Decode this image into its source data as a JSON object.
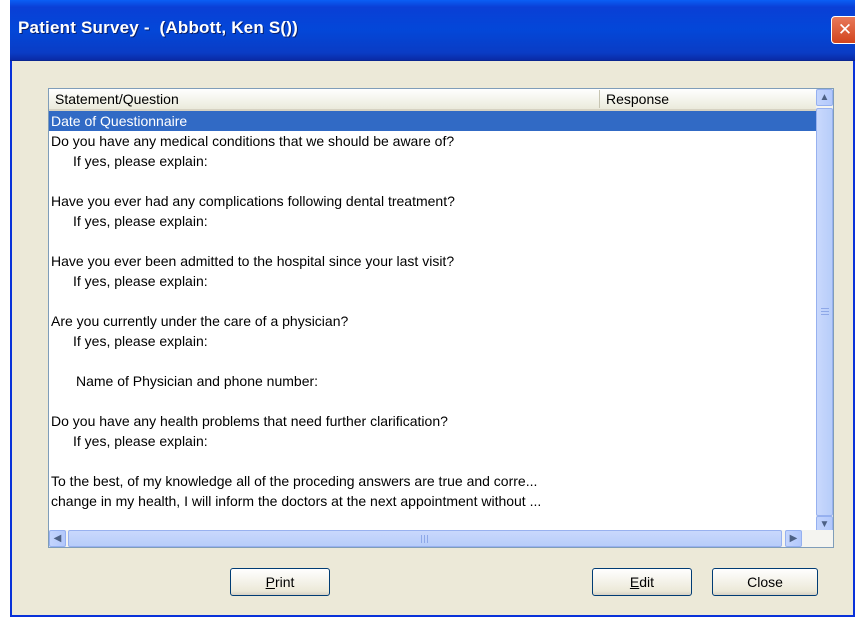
{
  "window": {
    "title": "Patient Survey -  (Abbott, Ken S())",
    "close_glyph": "✕"
  },
  "list": {
    "columns": [
      "Statement/Question",
      "Response"
    ],
    "rows": [
      {
        "text": "Date of Questionnaire",
        "indent": 0,
        "selected": true
      },
      {
        "text": "Do you have any medical conditions that we should be aware of?",
        "indent": 0
      },
      {
        "text": "If yes, please explain:",
        "indent": 1
      },
      {
        "text": "",
        "indent": 0
      },
      {
        "text": "Have you ever had any complications following dental treatment?",
        "indent": 0
      },
      {
        "text": "If yes, please explain:",
        "indent": 1
      },
      {
        "text": "",
        "indent": 0
      },
      {
        "text": "Have you ever been admitted to the hospital since your last visit?",
        "indent": 0
      },
      {
        "text": "If yes, please explain:",
        "indent": 1
      },
      {
        "text": "",
        "indent": 0
      },
      {
        "text": "Are you currently under the care of a physician?",
        "indent": 0
      },
      {
        "text": "If yes, please explain:",
        "indent": 1
      },
      {
        "text": "",
        "indent": 0
      },
      {
        "text": "Name of Physician and phone number:",
        "indent": 2
      },
      {
        "text": "",
        "indent": 0
      },
      {
        "text": "Do you have any health problems that need further clarification?",
        "indent": 0
      },
      {
        "text": "If yes, please explain:",
        "indent": 1
      },
      {
        "text": "",
        "indent": 0
      },
      {
        "text": "To the best, of my knowledge all of the proceding answers are true and corre...",
        "indent": 0
      },
      {
        "text": "change in my health, I will inform the doctors at the next appointment without ...",
        "indent": 0
      }
    ]
  },
  "scroll_arrows": {
    "up": "▲",
    "down": "▼",
    "left": "◀",
    "right": "▶"
  },
  "buttons": {
    "print": {
      "mnemonic": "P",
      "rest": "rint"
    },
    "edit": {
      "mnemonic": "E",
      "rest": "dit"
    },
    "close": {
      "label": "Close"
    }
  }
}
